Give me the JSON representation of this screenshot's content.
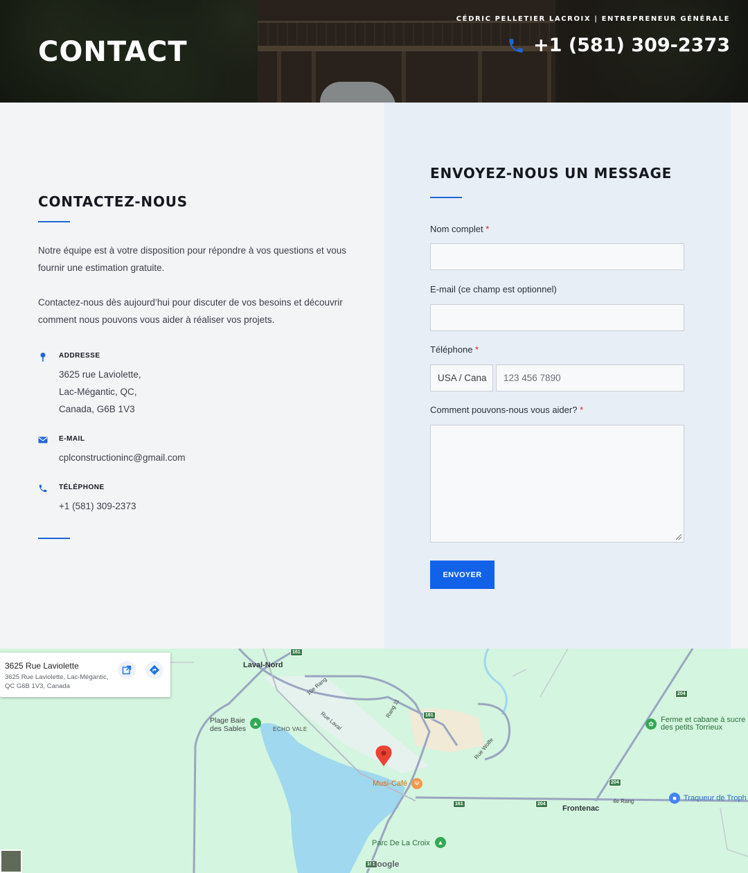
{
  "hero": {
    "title": "CONTACT",
    "tagline": "CÉDRIC PELLETIER LACROIX | ENTREPRENEUR GÉNÉRALE",
    "phone": "+1 (581) 309-2373"
  },
  "contact": {
    "heading": "CONTACTEZ-NOUS",
    "paragraph1": "Notre équipe est à votre disposition pour répondre à vos questions et vous fournir une estimation gratuite.",
    "paragraph2": "Contactez-nous dès aujourd’hui pour discuter de vos besoins et découvrir comment nous pouvons vous aider à réaliser vos projets.",
    "address_label": "ADDRESSE",
    "address_line1": "3625 rue Laviolette,",
    "address_line2": "Lac-Mégantic, QC,",
    "address_line3": "Canada, G6B 1V3",
    "email_label": "E-MAIL",
    "email_value": "cplconstructioninc@gmail.com",
    "phone_label": "TÉLÉPHONE",
    "phone_value": "+1 (581) 309-2373"
  },
  "form": {
    "heading": "ENVOYEZ-NOUS UN MESSAGE",
    "name_label": "Nom complet",
    "email_label": "E-mail (ce champ est optionnel)",
    "phone_label": "Téléphone",
    "country_value": "USA / Cana",
    "phone_placeholder": "123 456 7890",
    "message_label": "Comment pouvons-nous vous aider?",
    "required_mark": "*",
    "submit_label": "ENVOYER"
  },
  "map": {
    "card_title": "3625 Rue Laviolette",
    "card_address": "3625 Rue Laviolette, Lac-Mégantic, QC G6B 1V3, Canada",
    "labels": {
      "laval_nord": "Laval-Nord",
      "rang10": "10e Rang",
      "rue_laval": "Rue Laval",
      "rang11": "Rang 11",
      "plage1": "Plage Baie",
      "plage2": "des Sables",
      "echo_vale": "ECHO VALE",
      "musi_cafe": "Musi-Café",
      "rue_wolfe": "Rue Wolfe",
      "frontenac": "Frontenac",
      "rang4": "4e Rang",
      "ferme1": "Ferme et cabane à sucre",
      "ferme2": "des petits Torrieux",
      "traqueur": "Traqueur de Troph",
      "parc": "Parc De La Croix",
      "google": "Google",
      "r161a": "161",
      "r161b": "161",
      "r161c": "161",
      "r204a": "204",
      "r204b": "204",
      "r204c": "204",
      "r161d": "161"
    }
  },
  "colors": {
    "accent": "#1162e8",
    "required": "#d0262b",
    "map_bg": "#d4f5df",
    "lake": "#9fd8ef"
  }
}
